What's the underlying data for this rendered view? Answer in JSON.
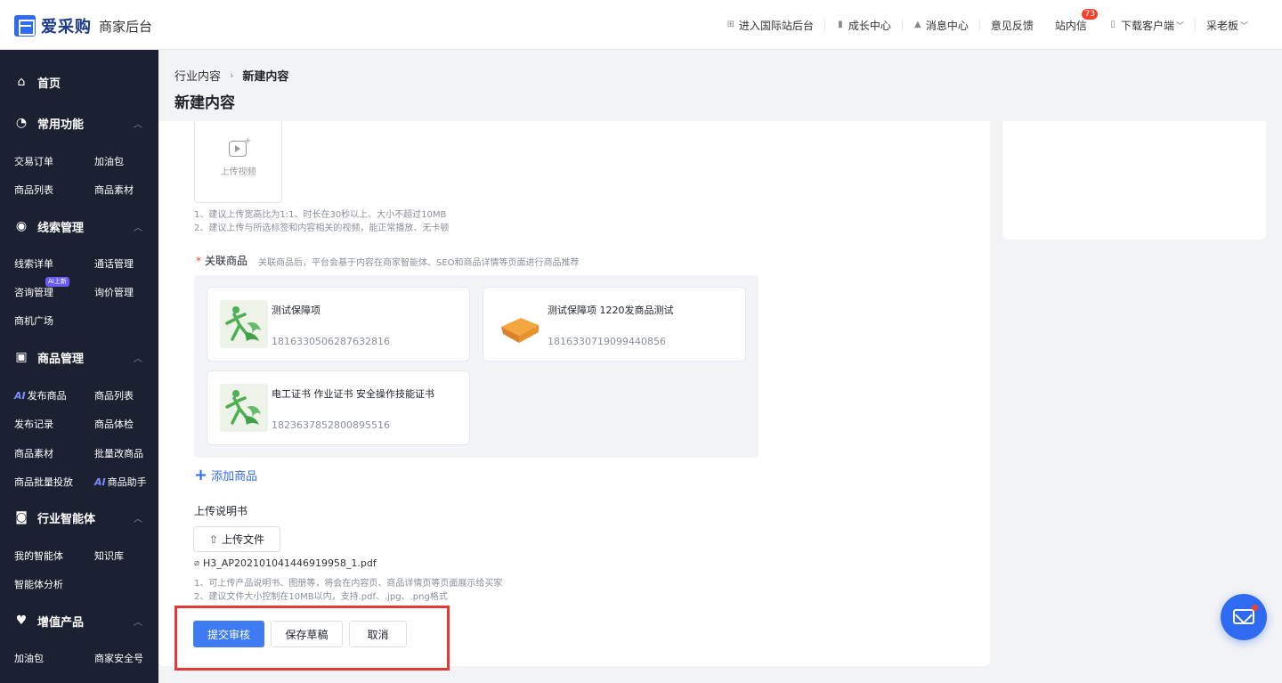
{
  "app": {
    "logo_text": "爱采购",
    "logo_sub": "商家后台"
  },
  "topnav": {
    "intl": "进入国际站后台",
    "growth": "成长中心",
    "message": "消息中心",
    "feedback": "意见反馈",
    "inbox": "站内信",
    "inbox_count": "73",
    "download": "下载客户端",
    "user": "采老板"
  },
  "sidebar": {
    "home": "首页",
    "common": {
      "title": "常用功能",
      "items": [
        "交易订单",
        "加油包",
        "商品列表",
        "商品素材"
      ]
    },
    "leads": {
      "title": "线索管理",
      "items": [
        "线索详单",
        "通话管理",
        "咨询管理",
        "询价管理",
        "商机广场"
      ],
      "badge": "AI上新"
    },
    "products": {
      "title": "商品管理",
      "items": [
        "发布商品",
        "商品列表",
        "发布记录",
        "商品体检",
        "商品素材",
        "批量改商品",
        "商品批量投放",
        "商品助手"
      ],
      "ai_mark": "AI"
    },
    "agent": {
      "title": "行业智能体",
      "items": [
        "我的智能体",
        "知识库",
        "智能体分析"
      ]
    },
    "value": {
      "title": "增值产品",
      "items": [
        "加油包",
        "商家安全号"
      ]
    }
  },
  "breadcrumb": {
    "parent": "行业内容",
    "current": "新建内容"
  },
  "page_title": "新建内容",
  "video": {
    "upload_label": "上传视频",
    "hint1": "1、建议上传宽高比为1:1、时长在30秒以上、大小不超过10MB",
    "hint2": "2、建议上传与所选标签和内容相关的视频，能正常播放、无卡顿"
  },
  "related": {
    "required_mark": "*",
    "label": "关联商品",
    "desc": "关联商品后，平台会基于内容在商家智能体、SEO和商品详情等页面进行商品推荐",
    "products": [
      {
        "name": "测试保障项",
        "id": "1816330506287632816"
      },
      {
        "name": "测试保障项 1220发商品测试",
        "id": "1816330719099440856"
      },
      {
        "name": "电工证书 作业证书 安全操作技能证书",
        "id": "1823637852800895516"
      }
    ],
    "add_label": "添加商品"
  },
  "manual": {
    "label": "上传说明书",
    "upload_btn": "上传文件",
    "file_name": "H3_AP202101041446919958_1.pdf",
    "hint1": "1、可上传产品说明书、图册等，将会在内容页、商品详情页等页面展示给买家",
    "hint2": "2、建议文件大小控制在10MB以内，支持.pdf、.jpg、.png格式"
  },
  "actions": {
    "submit": "提交审核",
    "draft": "保存草稿",
    "cancel": "取消"
  },
  "colors": {
    "primary": "#2f6bf2",
    "sidebar_bg": "#1b2130",
    "highlight_border": "#e53935"
  }
}
